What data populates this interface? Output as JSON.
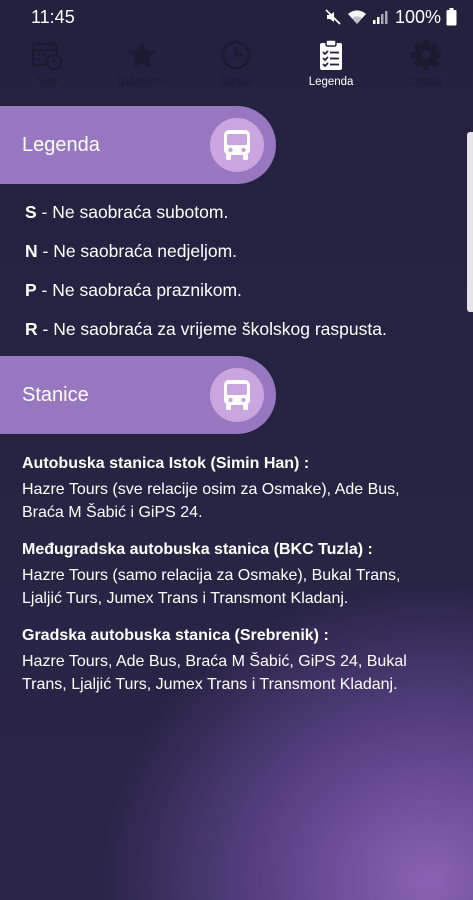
{
  "status_bar": {
    "time": "11:45",
    "battery": "100%",
    "icons": [
      "mute-icon",
      "wifi-icon",
      "signal-icon",
      "battery-icon"
    ]
  },
  "tabs": [
    {
      "label": "Sve",
      "icon": "calendar-clock-icon",
      "active": false
    },
    {
      "label": "Izdvojeno",
      "icon": "star-icon",
      "active": false
    },
    {
      "label": "Danas",
      "icon": "clock-icon",
      "active": false
    },
    {
      "label": "Legenda",
      "icon": "clipboard-checklist-icon",
      "active": true
    },
    {
      "label": "Ostalo",
      "icon": "gear-icon",
      "active": false
    }
  ],
  "legend_section": {
    "title": "Legenda",
    "icon": "bus-icon",
    "items": [
      {
        "code": "S",
        "text": " - Ne saobraća subotom."
      },
      {
        "code": "N",
        "text": " - Ne saobraća nedjeljom."
      },
      {
        "code": "P",
        "text": " - Ne saobraća praznikom."
      },
      {
        "code": "R",
        "text": " - Ne saobraća za vrijeme školskog raspusta."
      }
    ]
  },
  "stations_section": {
    "title": "Stanice",
    "icon": "bus-icon",
    "items": [
      {
        "name": "Autobuska stanica Istok (Simin Han) :",
        "operators": "Hazre Tours (sve relacije osim za Osmake), Ade Bus, Braća M Šabić i GiPS 24."
      },
      {
        "name": "Međugradska autobuska stanica (BKC Tuzla) :",
        "operators": "Hazre Tours (samo relacija za Osmake), Bukal Trans, Ljaljić Turs, Jumex Trans i Transmont Kladanj."
      },
      {
        "name": "Gradska autobuska stanica (Srebrenik) :",
        "operators": "Hazre Tours, Ade Bus, Braća M Šabić, GiPS 24, Bukal Trans, Ljaljić Turs, Jumex Trans i Transmont Kladanj."
      }
    ]
  },
  "colors": {
    "background": "#25223f",
    "header_pill": "#9677c0",
    "icon_circle": "#c9a6df",
    "inactive_tab": "#1c1a30"
  }
}
